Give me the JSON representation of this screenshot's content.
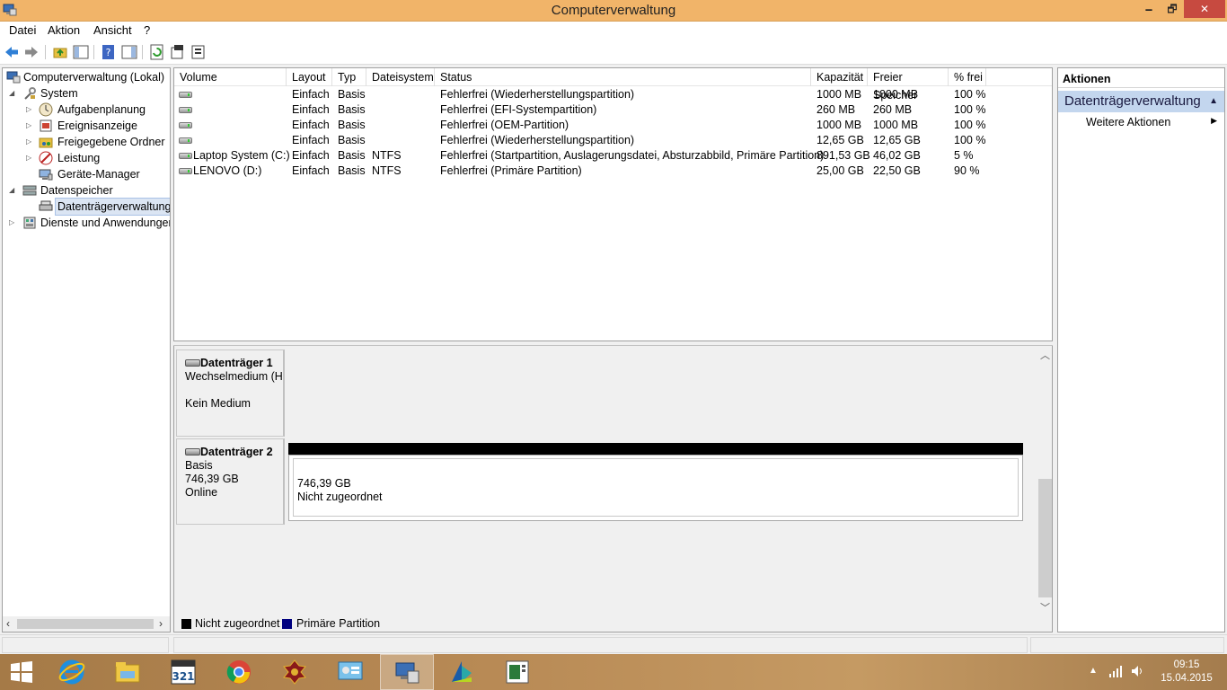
{
  "window": {
    "title": "Computerverwaltung",
    "min_glyph": "🗕",
    "max_glyph": "🗗",
    "close_glyph": "✕"
  },
  "menu": [
    "Datei",
    "Aktion",
    "Ansicht",
    "?"
  ],
  "toolbar_icons": [
    "back-icon",
    "forward-icon",
    "up-folder-icon",
    "show-hide-console-tree-icon",
    "help-icon",
    "show-hide-action-pane-icon",
    "refresh-icon",
    "properties-icon",
    "export-icon"
  ],
  "tree": [
    {
      "label": "Computerverwaltung (Lokal)",
      "level": 0,
      "expander": "",
      "icon": "computer-management-icon"
    },
    {
      "label": "System",
      "level": 1,
      "expander": "◢",
      "icon": "system-tools-icon"
    },
    {
      "label": "Aufgabenplanung",
      "level": 2,
      "expander": "▷",
      "icon": "task-scheduler-icon"
    },
    {
      "label": "Ereignisanzeige",
      "level": 2,
      "expander": "▷",
      "icon": "event-viewer-icon"
    },
    {
      "label": "Freigegebene Ordner",
      "level": 2,
      "expander": "▷",
      "icon": "shared-folders-icon"
    },
    {
      "label": "Leistung",
      "level": 2,
      "expander": "▷",
      "icon": "performance-icon"
    },
    {
      "label": "Geräte-Manager",
      "level": 2,
      "expander": "",
      "icon": "device-manager-icon"
    },
    {
      "label": "Datenspeicher",
      "level": 1,
      "expander": "◢",
      "icon": "storage-icon"
    },
    {
      "label": "Datenträgerverwaltung",
      "level": 2,
      "expander": "",
      "icon": "disk-management-icon",
      "selected": true
    },
    {
      "label": "Dienste und Anwendungen",
      "level": 1,
      "expander": "▷",
      "icon": "services-apps-icon"
    }
  ],
  "volume_columns": [
    "Volume",
    "Layout",
    "Typ",
    "Dateisystem",
    "Status",
    "Kapazität",
    "Freier Speicher",
    "% frei"
  ],
  "volumes": [
    {
      "volume": "",
      "layout": "Einfach",
      "typ": "Basis",
      "fs": "",
      "status": "Fehlerfrei (Wiederherstellungspartition)",
      "kap": "1000 MB",
      "frei": "1000 MB",
      "pct": "100 %"
    },
    {
      "volume": "",
      "layout": "Einfach",
      "typ": "Basis",
      "fs": "",
      "status": "Fehlerfrei (EFI-Systempartition)",
      "kap": "260 MB",
      "frei": "260 MB",
      "pct": "100 %"
    },
    {
      "volume": "",
      "layout": "Einfach",
      "typ": "Basis",
      "fs": "",
      "status": "Fehlerfrei (OEM-Partition)",
      "kap": "1000 MB",
      "frei": "1000 MB",
      "pct": "100 %"
    },
    {
      "volume": "",
      "layout": "Einfach",
      "typ": "Basis",
      "fs": "",
      "status": "Fehlerfrei (Wiederherstellungspartition)",
      "kap": "12,65 GB",
      "frei": "12,65 GB",
      "pct": "100 %"
    },
    {
      "volume": "Laptop System (C:)",
      "layout": "Einfach",
      "typ": "Basis",
      "fs": "NTFS",
      "status": "Fehlerfrei (Startpartition, Auslagerungsdatei, Absturzabbild, Primäre Partition)",
      "kap": "891,53 GB",
      "frei": "46,02 GB",
      "pct": "5 %"
    },
    {
      "volume": "LENOVO (D:)",
      "layout": "Einfach",
      "typ": "Basis",
      "fs": "NTFS",
      "status": "Fehlerfrei (Primäre Partition)",
      "kap": "25,00 GB",
      "frei": "22,50 GB",
      "pct": "90 %"
    }
  ],
  "disks": [
    {
      "name": "Datenträger 1",
      "type": "Wechselmedium (H:)",
      "size": "",
      "state": "Kein Medium"
    },
    {
      "name": "Datenträger 2",
      "type": "Basis",
      "size": "746,39 GB",
      "state": "Online",
      "partition": {
        "size": "746,39 GB",
        "label": "Nicht zugeordnet"
      }
    }
  ],
  "legend": [
    {
      "label": "Nicht zugeordnet",
      "color": "#000000"
    },
    {
      "label": "Primäre Partition",
      "color": "#00007f"
    }
  ],
  "actions": {
    "header": "Aktionen",
    "section": "Datenträgerverwaltung",
    "item": "Weitere Aktionen"
  },
  "taskbar": {
    "apps": [
      "start-icon",
      "internet-explorer-icon",
      "file-explorer-icon",
      "media-player-321-icon",
      "chrome-icon",
      "game-icon",
      "control-panel-icon",
      "computer-management-icon",
      "app-icon",
      "document-app-icon"
    ],
    "time": "09:15",
    "date": "15.04.2015"
  }
}
